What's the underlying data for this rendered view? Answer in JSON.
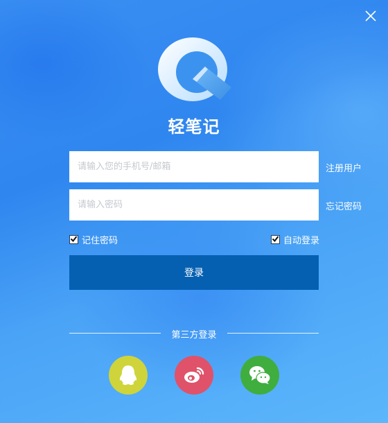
{
  "window": {
    "close_icon": "close-icon"
  },
  "app": {
    "title": "轻笔记",
    "logo_icon": "q-logo-icon"
  },
  "form": {
    "phone_placeholder": "请输入您的手机号/邮箱",
    "phone_value": "",
    "password_placeholder": "请输入密码",
    "password_value": "",
    "register_label": "注册用户",
    "forgot_label": "忘记密码",
    "remember_label": "记住密码",
    "remember_checked": true,
    "autologin_label": "自动登录",
    "autologin_checked": true,
    "login_label": "登录"
  },
  "third_party": {
    "label": "第三方登录",
    "providers": [
      {
        "name": "qq-icon",
        "color": "#cfd43a"
      },
      {
        "name": "weibo-icon",
        "color": "#e0526a"
      },
      {
        "name": "wechat-icon",
        "color": "#3fae3f"
      }
    ]
  },
  "colors": {
    "background": "#3a8ff2",
    "login_button": "#0660b1"
  }
}
